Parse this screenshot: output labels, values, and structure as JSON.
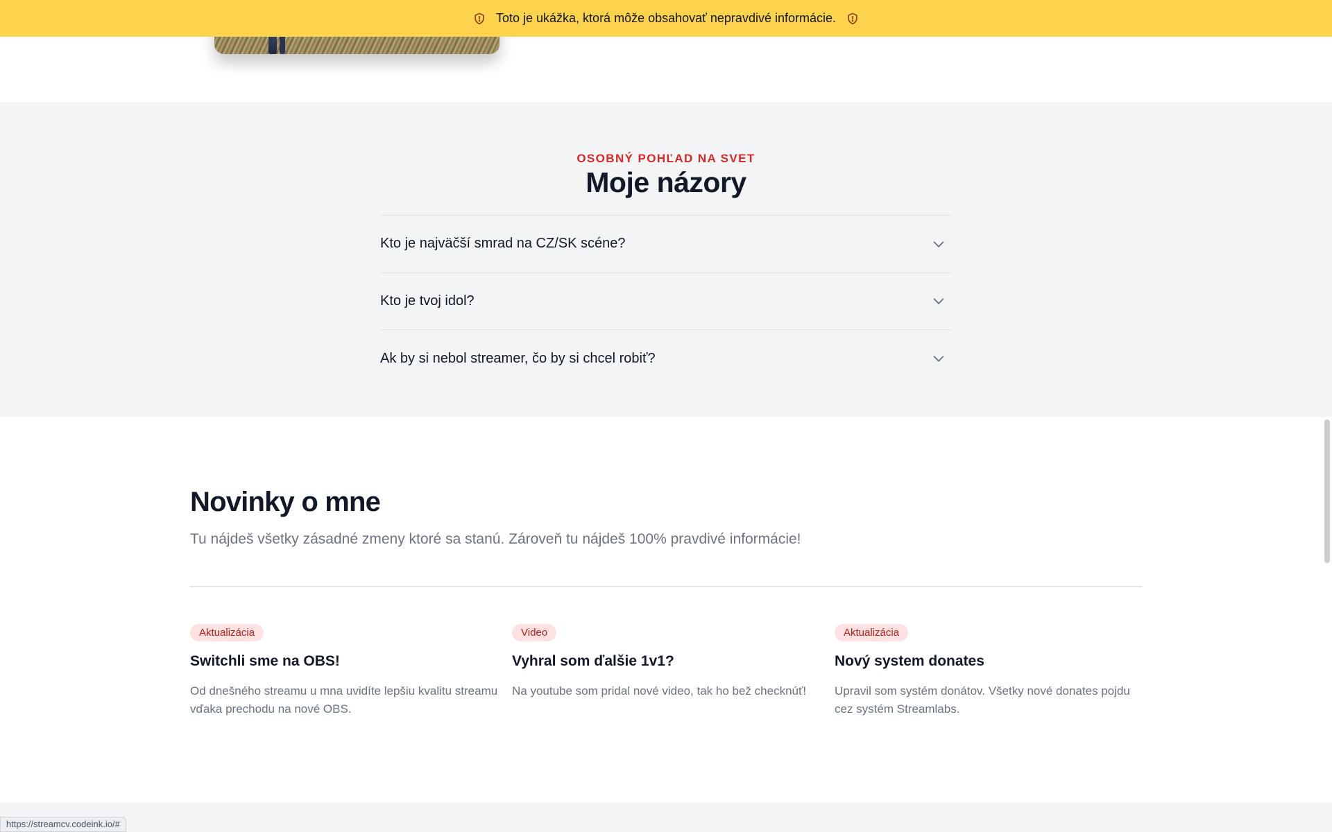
{
  "banner": {
    "text": "Toto je ukážka, ktorá môže obsahovať nepravdivé informácie.",
    "icons": [
      "shield-alert-icon",
      "shield-alert-icon"
    ],
    "background": "#fcd34d"
  },
  "opinions": {
    "eyebrow": "OSOBNÝ POHĽAD NA SVET",
    "title": "Moje názory",
    "faq": [
      {
        "question": "Kto je najväčší smrad na CZ/SK scéne?"
      },
      {
        "question": "Kto je tvoj idol?"
      },
      {
        "question": "Ak by si nebol streamer, čo by si chcel robiť?"
      }
    ]
  },
  "news": {
    "title": "Novinky o mne",
    "intro": "Tu nájdeš všetky zásadné zmeny ktoré sa stanú. Zároveň tu nájdeš 100% pravdivé informácie!",
    "cards": [
      {
        "badge": "Aktualizácia",
        "title": "Switchli sme na OBS!",
        "text": "Od dnešného streamu u mna uvidíte lepšiu kvalitu streamu vďaka prechodu na nové OBS."
      },
      {
        "badge": "Video",
        "title": "Vyhral som ďalšie 1v1?",
        "text": "Na youtube som pridal nové video, tak ho bež checknúť!"
      },
      {
        "badge": "Aktualizácia",
        "title": "Nový system donates",
        "text": "Upravil som systém donátov. Všetky nové donates pojdu cez systém Streamlabs."
      }
    ]
  },
  "status_bar": {
    "url": "https://streamcv.codeink.io/#"
  },
  "colors": {
    "accent": "#dc2626",
    "badge_bg": "#fee2e2",
    "badge_text": "#b91c1c",
    "section_bg": "#f3f4f6"
  }
}
